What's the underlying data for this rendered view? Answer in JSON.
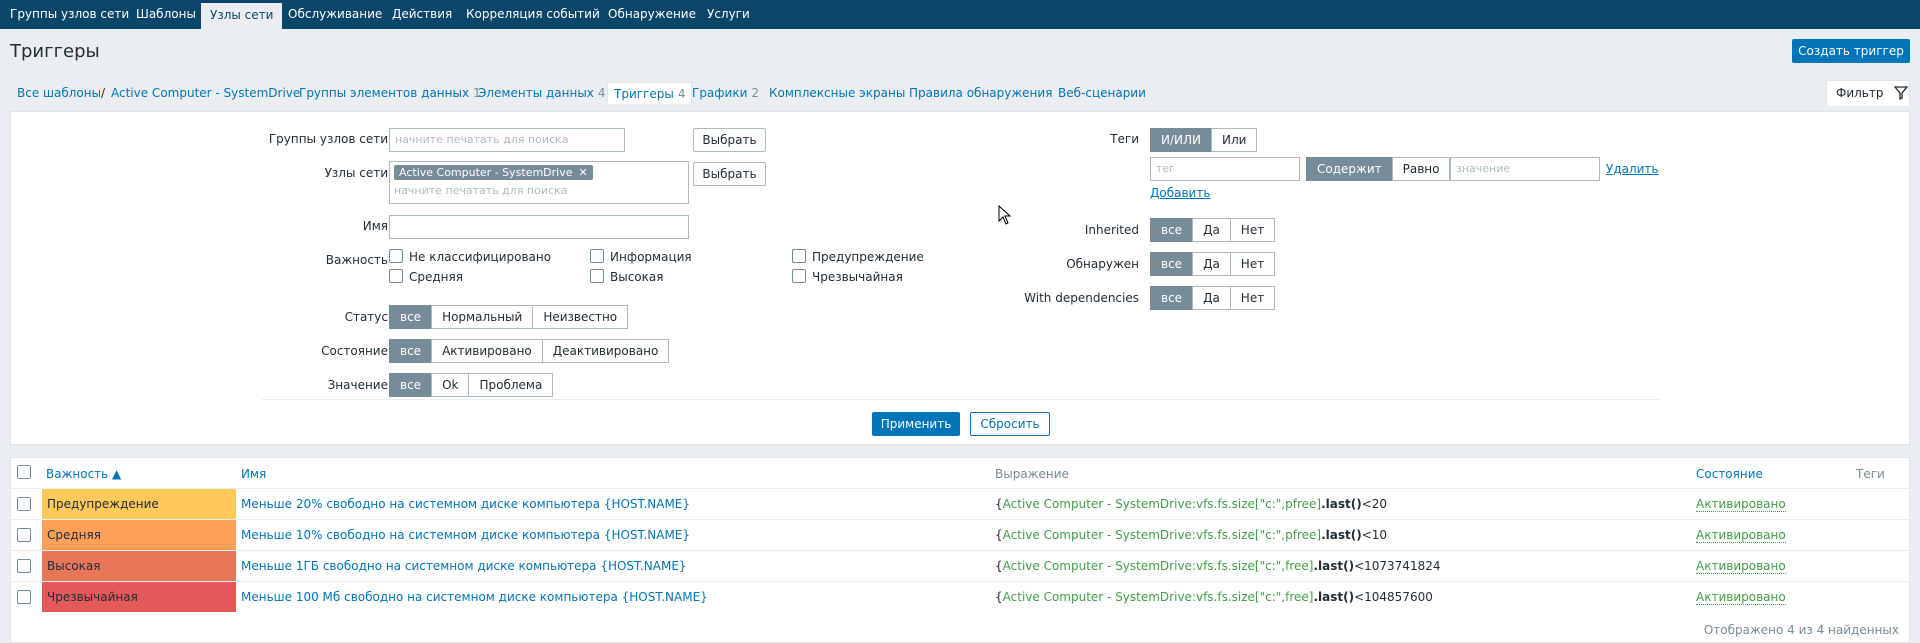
{
  "nav": {
    "items": [
      "Группы узлов сети",
      "Шаблоны",
      "Узлы сети",
      "Обслуживание",
      "Действия",
      "Корреляция событий",
      "Обнаружение",
      "Услуги"
    ]
  },
  "header": {
    "title": "Триггеры",
    "create_button": "Создать триггер"
  },
  "breadcrumb": {
    "all_templates": "Все шаблоны",
    "separator": "/",
    "host": "Active Computer - SystemDrive"
  },
  "tabs": [
    {
      "label": "Группы элементов данных",
      "count": "1"
    },
    {
      "label": "Элементы данных",
      "count": "4"
    },
    {
      "label": "Триггеры",
      "count": "4"
    },
    {
      "label": "Графики",
      "count": "2"
    },
    {
      "label": "Комплексные экраны",
      "count": ""
    },
    {
      "label": "Правила обнаружения",
      "count": ""
    },
    {
      "label": "Веб-сценарии",
      "count": ""
    }
  ],
  "filter_tab": {
    "label": "Фильтр",
    "icon": "filter-icon"
  },
  "filter": {
    "host_groups": {
      "label": "Группы узлов сети",
      "placeholder": "начните печатать для поиска",
      "select": "Выбрать"
    },
    "hosts": {
      "label": "Узлы сети",
      "tag": "Active Computer - SystemDrive",
      "placeholder": "начните печатать для поиска",
      "select": "Выбрать"
    },
    "name": {
      "label": "Имя",
      "value": ""
    },
    "severity": {
      "label": "Важность",
      "options": [
        "Не классифицировано",
        "Информация",
        "Предупреждение",
        "Средняя",
        "Высокая",
        "Чрезвычайная"
      ]
    },
    "status": {
      "label": "Статус",
      "options": [
        "все",
        "Нормальный",
        "Неизвестно"
      ],
      "selected": "все"
    },
    "state": {
      "label": "Состояние",
      "options": [
        "все",
        "Активировано",
        "Деактивировано"
      ],
      "selected": "все"
    },
    "value": {
      "label": "Значение",
      "options": [
        "все",
        "Ok",
        "Проблема"
      ],
      "selected": "все"
    },
    "tags": {
      "label": "Теги",
      "mode": [
        "И/ИЛИ",
        "Или"
      ],
      "tag_placeholder": "тег",
      "operator": [
        "Содержит",
        "Равно"
      ],
      "value_placeholder": "значение",
      "remove": "Удалить",
      "add": "Добавить"
    },
    "inherited": {
      "label": "Inherited",
      "options": [
        "все",
        "Да",
        "Нет"
      ]
    },
    "discovered": {
      "label": "Обнаружен",
      "options": [
        "все",
        "Да",
        "Нет"
      ]
    },
    "dependencies": {
      "label": "With dependencies",
      "options": [
        "все",
        "Да",
        "Нет"
      ]
    },
    "apply": "Применить",
    "reset": "Сбросить"
  },
  "table": {
    "headers": {
      "severity": "Важность ▲",
      "name": "Имя",
      "expression": "Выражение",
      "state": "Состояние",
      "tags": "Теги"
    },
    "rows": [
      {
        "severity": "Предупреждение",
        "color": "#ffc859",
        "name": "Меньше 20% свободно на системном диске компьютера {HOST.NAME}",
        "expr_open": "{",
        "expr_item": "Active Computer - SystemDrive:vfs.fs.size[\"c:\",pfree]",
        "expr_fn": ".last()",
        "expr_tail": "<20",
        "state": "Активировано"
      },
      {
        "severity": "Средняя",
        "color": "#ffa059",
        "name": "Меньше 10% свободно на системном диске компьютера {HOST.NAME}",
        "expr_open": "{",
        "expr_item": "Active Computer - SystemDrive:vfs.fs.size[\"c:\",pfree]",
        "expr_fn": ".last()",
        "expr_tail": "<10",
        "state": "Активировано"
      },
      {
        "severity": "Высокая",
        "color": "#e97659",
        "name": "Меньше 1ГБ свободно на системном диске компьютера {HOST.NAME}",
        "expr_open": "{",
        "expr_item": "Active Computer - SystemDrive:vfs.fs.size[\"c:\",free]",
        "expr_fn": ".last()",
        "expr_tail": "<1073741824",
        "state": "Активировано"
      },
      {
        "severity": "Чрезвычайная",
        "color": "#e45959",
        "name": "Меньше 100 Мб свободно на системном диске компьютера {HOST.NAME}",
        "expr_open": "{",
        "expr_item": "Active Computer - SystemDrive:vfs.fs.size[\"c:\",free]",
        "expr_fn": ".last()",
        "expr_tail": "<104857600",
        "state": "Активировано"
      }
    ],
    "footer": "Отображено 4 из 4 найденных"
  }
}
